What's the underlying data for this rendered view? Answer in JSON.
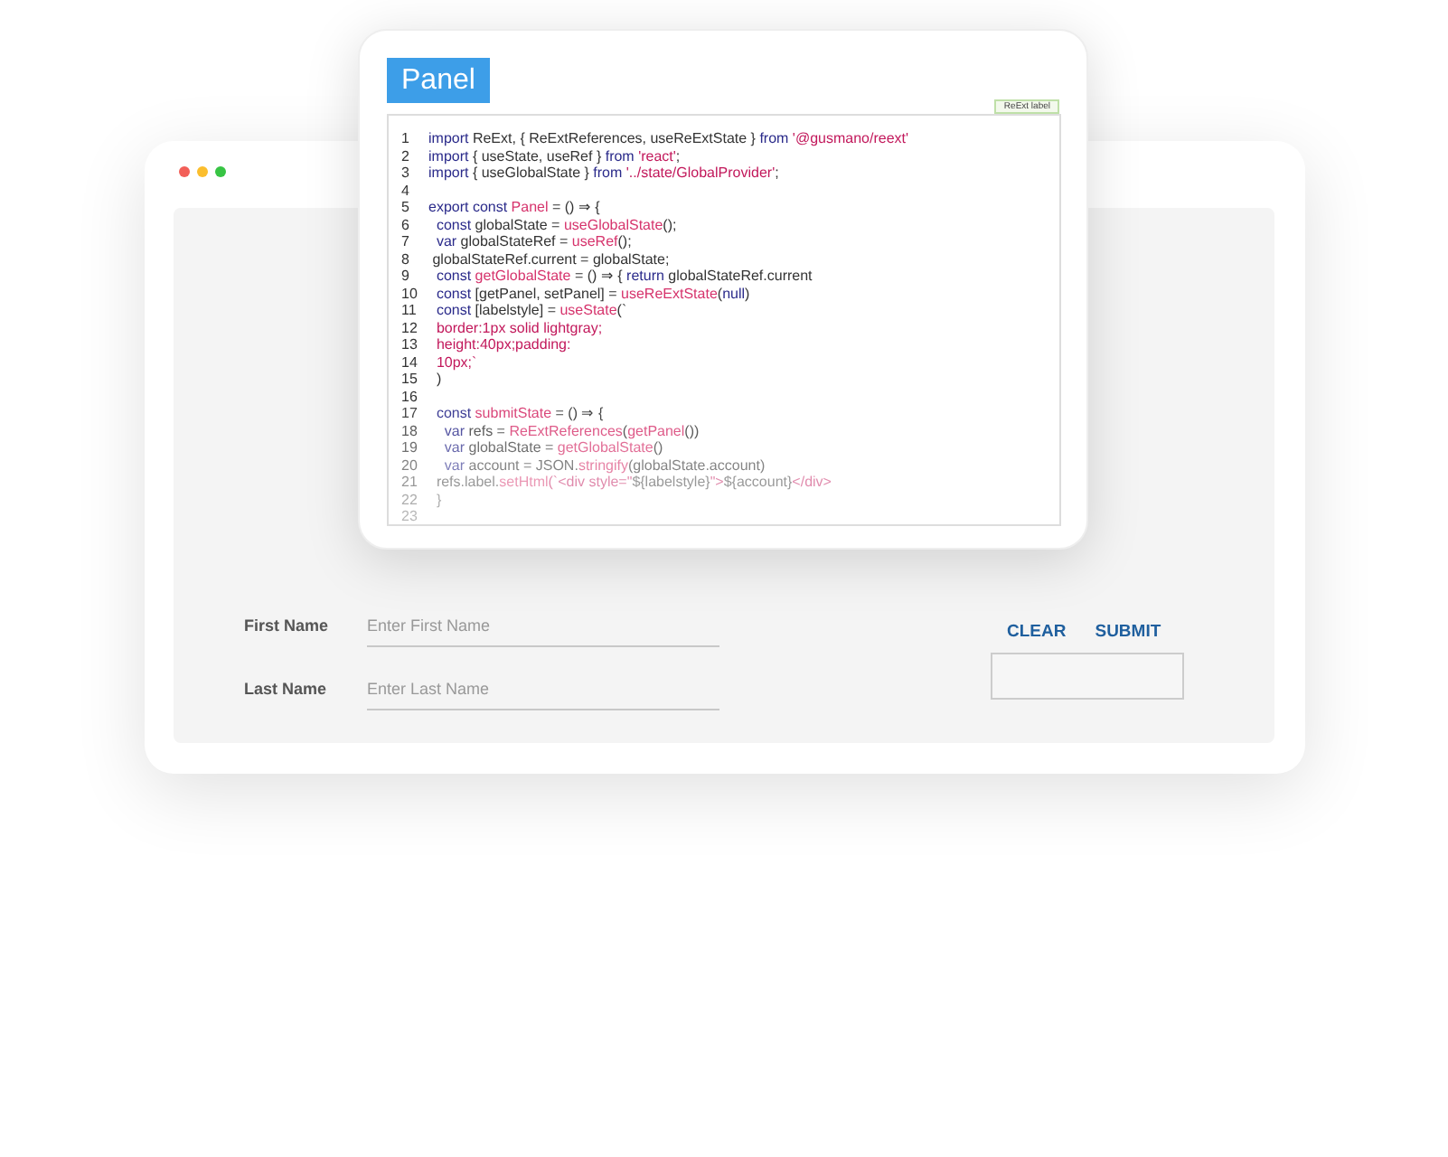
{
  "browser": {
    "dots": [
      {
        "color": "#f25f58"
      },
      {
        "color": "#fbbe2e"
      },
      {
        "color": "#37c444"
      }
    ]
  },
  "form": {
    "fields": [
      {
        "label": "First Name",
        "placeholder": "Enter First Name"
      },
      {
        "label": "Last Name",
        "placeholder": "Enter Last Name"
      }
    ],
    "buttons": [
      "CLEAR",
      "SUBMIT"
    ]
  },
  "panel": {
    "title": "Panel",
    "badge": "ReExt label",
    "code_lines": [
      {
        "number": "1",
        "tokens": [
          {
            "t": "import",
            "kind": "kw"
          },
          {
            "t": " ReExt, { ReExtReferences, useReExtState } ",
            "kind": "plain"
          },
          {
            "t": "from",
            "kind": "kw"
          },
          {
            "t": " '@gusmano/reext'",
            "kind": "str"
          }
        ]
      },
      {
        "number": "2",
        "tokens": [
          {
            "t": "import",
            "kind": "kw"
          },
          {
            "t": " { useState, useRef } ",
            "kind": "plain"
          },
          {
            "t": "from",
            "kind": "kw"
          },
          {
            "t": " 'react'",
            "kind": "str"
          },
          {
            "t": ";",
            "kind": "plain"
          }
        ]
      },
      {
        "number": "3",
        "tokens": [
          {
            "t": "import",
            "kind": "kw"
          },
          {
            "t": " { useGlobalState } ",
            "kind": "plain"
          },
          {
            "t": "from",
            "kind": "kw"
          },
          {
            "t": " '../state/GlobalProvider'",
            "kind": "str"
          },
          {
            "t": ";",
            "kind": "plain"
          }
        ]
      },
      {
        "number": "4"
      },
      {
        "number": "5",
        "tokens": [
          {
            "t": "export const",
            "kind": "kw"
          },
          {
            "t": " Panel",
            "kind": "fn"
          },
          {
            "t": " = () ⇒ {",
            "kind": "plain"
          }
        ]
      },
      {
        "number": "6",
        "tokens": [
          {
            "t": "  const",
            "kind": "kw"
          },
          {
            "t": " globalState = ",
            "kind": "plain"
          },
          {
            "t": "useGlobalState",
            "kind": "fn"
          },
          {
            "t": "();",
            "kind": "plain"
          }
        ]
      },
      {
        "number": "7",
        "tokens": [
          {
            "t": "  var",
            "kind": "kw"
          },
          {
            "t": " globalStateRef = ",
            "kind": "plain"
          },
          {
            "t": "useRef",
            "kind": "fn"
          },
          {
            "t": "();",
            "kind": "plain"
          }
        ]
      },
      {
        "number": "8",
        "tokens": [
          {
            "t": " globalStateRef.current = globalState;",
            "kind": "plain"
          }
        ]
      },
      {
        "number": "9",
        "tokens": [
          {
            "t": "  const",
            "kind": "kw"
          },
          {
            "t": " getGlobalState",
            "kind": "fn"
          },
          {
            "t": " = () ⇒ { ",
            "kind": "plain"
          },
          {
            "t": "return",
            "kind": "kw"
          },
          {
            "t": " globalStateRef.current",
            "kind": "plain"
          }
        ]
      },
      {
        "number": "10",
        "tokens": [
          {
            "t": "  const",
            "kind": "kw"
          },
          {
            "t": " [getPanel, setPanel] = ",
            "kind": "plain"
          },
          {
            "t": "useReExtState",
            "kind": "fn"
          },
          {
            "t": "(",
            "kind": "plain"
          },
          {
            "t": "null",
            "kind": "kw"
          },
          {
            "t": ")",
            "kind": "plain"
          }
        ]
      },
      {
        "number": "11",
        "tokens": [
          {
            "t": "  const",
            "kind": "kw"
          },
          {
            "t": " [labelstyle] = ",
            "kind": "plain"
          },
          {
            "t": "useState",
            "kind": "fn"
          },
          {
            "t": "(`",
            "kind": "plain"
          }
        ]
      },
      {
        "number": "12",
        "tokens": [
          {
            "t": "  border:1px solid lightgray;",
            "kind": "str"
          }
        ]
      },
      {
        "number": "13",
        "tokens": [
          {
            "t": "  height:40px;padding:",
            "kind": "str"
          }
        ]
      },
      {
        "number": "14",
        "tokens": [
          {
            "t": "  10px;`",
            "kind": "str"
          }
        ]
      },
      {
        "number": "15",
        "tokens": [
          {
            "t": "  )",
            "kind": "plain"
          }
        ]
      },
      {
        "number": "16"
      },
      {
        "number": "17",
        "tokens": [
          {
            "t": "  const",
            "kind": "kw"
          },
          {
            "t": " submitState",
            "kind": "fn"
          },
          {
            "t": " = () ⇒ {",
            "kind": "plain"
          }
        ]
      },
      {
        "number": "18",
        "tokens": [
          {
            "t": "    var",
            "kind": "kw"
          },
          {
            "t": " refs = ",
            "kind": "plain"
          },
          {
            "t": "ReExtReferences",
            "kind": "fn"
          },
          {
            "t": "(",
            "kind": "plain"
          },
          {
            "t": "getPanel",
            "kind": "fn"
          },
          {
            "t": "())",
            "kind": "plain"
          }
        ]
      },
      {
        "number": "19",
        "tokens": [
          {
            "t": "    var",
            "kind": "kw"
          },
          {
            "t": " globalState = ",
            "kind": "plain"
          },
          {
            "t": "getGlobalState",
            "kind": "fn"
          },
          {
            "t": "()",
            "kind": "plain"
          }
        ]
      },
      {
        "number": "20",
        "tokens": [
          {
            "t": "    var",
            "kind": "kw"
          },
          {
            "t": " account = JSON.",
            "kind": "plain"
          },
          {
            "t": "stringify",
            "kind": "fn"
          },
          {
            "t": "(globalState.account)",
            "kind": "plain"
          }
        ]
      },
      {
        "number": "21",
        "tokens": [
          {
            "t": "  refs.label.",
            "kind": "plain"
          },
          {
            "t": "setHtml",
            "kind": "fn"
          },
          {
            "t": "(`<div style=\"",
            "kind": "str"
          },
          {
            "t": "${labelstyle}",
            "kind": "plain"
          },
          {
            "t": "\">",
            "kind": "str"
          },
          {
            "t": "${account}",
            "kind": "plain"
          },
          {
            "t": "</div>",
            "kind": "str"
          }
        ]
      },
      {
        "number": "22",
        "tokens": [
          {
            "t": "  }",
            "kind": "plain"
          }
        ]
      },
      {
        "number": "23"
      }
    ]
  }
}
